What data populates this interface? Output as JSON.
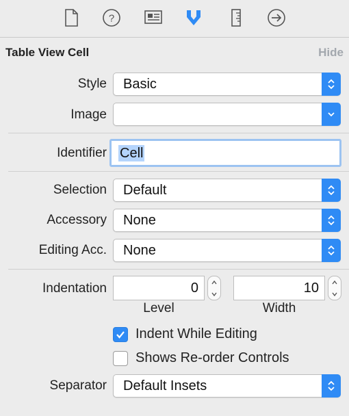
{
  "toolbar": {
    "tabs": [
      {
        "icon": "file-inspector-icon"
      },
      {
        "icon": "quick-help-icon"
      },
      {
        "icon": "identity-inspector-icon"
      },
      {
        "icon": "attributes-inspector-icon",
        "active": true
      },
      {
        "icon": "size-inspector-icon"
      },
      {
        "icon": "connections-inspector-icon"
      }
    ],
    "active_color": "#2f8bf5"
  },
  "section": {
    "title": "Table View Cell",
    "hide_label": "Hide"
  },
  "fields": {
    "style": {
      "label": "Style",
      "value": "Basic"
    },
    "image": {
      "label": "Image",
      "value": ""
    },
    "identifier": {
      "label": "Identifier",
      "value": "Cell"
    },
    "selection": {
      "label": "Selection",
      "value": "Default"
    },
    "accessory": {
      "label": "Accessory",
      "value": "None"
    },
    "editing_acc": {
      "label": "Editing Acc.",
      "value": "None"
    },
    "indentation": {
      "label": "Indentation",
      "level": {
        "value": "0",
        "caption": "Level"
      },
      "width": {
        "value": "10",
        "caption": "Width"
      }
    },
    "indent_while_editing": {
      "label": "Indent While Editing",
      "checked": true
    },
    "shows_reorder": {
      "label": "Shows Re-order Controls",
      "checked": false
    },
    "separator": {
      "label": "Separator",
      "value": "Default Insets"
    }
  }
}
